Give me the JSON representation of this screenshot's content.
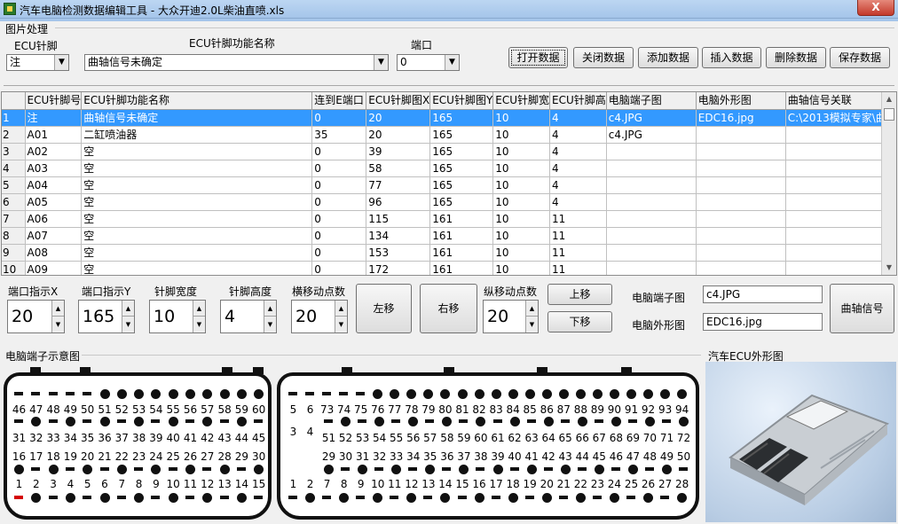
{
  "window": {
    "title": "汽车电脑检测数据编辑工具 - 大众开迪2.0L柴油直喷.xls",
    "close": "X"
  },
  "image_section": {
    "title": "图片处理"
  },
  "fields": {
    "ecu_pin": {
      "label": "ECU针脚",
      "value": "注"
    },
    "ecu_func": {
      "label": "ECU针脚功能名称",
      "value": "曲轴信号未确定"
    },
    "port": {
      "label": "端口",
      "value": "0"
    }
  },
  "buttons": {
    "open": "打开数据",
    "close": "关闭数据",
    "add": "添加数据",
    "insert": "插入数据",
    "delete": "删除数据",
    "save": "保存数据",
    "left": "左移",
    "right": "右移",
    "up": "上移",
    "down": "下移",
    "crank": "曲轴信号"
  },
  "table": {
    "columns": [
      "ECU针脚号",
      "ECU针脚功能名称",
      "连到E端口",
      "ECU针脚图X",
      "ECU针脚图Y",
      "ECU针脚宽",
      "ECU针脚高",
      "电脑端子图",
      "电脑外形图",
      "曲轴信号关联"
    ],
    "rows": [
      {
        "n": "1",
        "c": [
          "注",
          "曲轴信号未确定",
          "0",
          "20",
          "165",
          "10",
          "4",
          "c4.JPG",
          "EDC16.jpg",
          "C:\\2013模拟专家\\曲"
        ]
      },
      {
        "n": "2",
        "c": [
          "A01",
          "二缸喷油器",
          "35",
          "20",
          "165",
          "10",
          "4",
          "c4.JPG",
          "",
          ""
        ]
      },
      {
        "n": "3",
        "c": [
          "A02",
          "空",
          "0",
          "39",
          "165",
          "10",
          "4",
          "",
          "",
          ""
        ]
      },
      {
        "n": "4",
        "c": [
          "A03",
          "空",
          "0",
          "58",
          "165",
          "10",
          "4",
          "",
          "",
          ""
        ]
      },
      {
        "n": "5",
        "c": [
          "A04",
          "空",
          "0",
          "77",
          "165",
          "10",
          "4",
          "",
          "",
          ""
        ]
      },
      {
        "n": "6",
        "c": [
          "A05",
          "空",
          "0",
          "96",
          "165",
          "10",
          "4",
          "",
          "",
          ""
        ]
      },
      {
        "n": "7",
        "c": [
          "A06",
          "空",
          "0",
          "115",
          "161",
          "10",
          "11",
          "",
          "",
          ""
        ]
      },
      {
        "n": "8",
        "c": [
          "A07",
          "空",
          "0",
          "134",
          "161",
          "10",
          "11",
          "",
          "",
          ""
        ]
      },
      {
        "n": "9",
        "c": [
          "A08",
          "空",
          "0",
          "153",
          "161",
          "10",
          "11",
          "",
          "",
          ""
        ]
      },
      {
        "n": "10",
        "c": [
          "A09",
          "空",
          "0",
          "172",
          "161",
          "10",
          "11",
          "",
          "",
          ""
        ]
      }
    ]
  },
  "controls": {
    "port_x": {
      "label": "端口指示X",
      "value": "20"
    },
    "port_y": {
      "label": "端口指示Y",
      "value": "165"
    },
    "pin_width": {
      "label": "针脚宽度",
      "value": "10"
    },
    "pin_height": {
      "label": "针脚高度",
      "value": "4"
    },
    "hmove": {
      "label": "横移动点数",
      "value": "20"
    },
    "vmove": {
      "label": "纵移动点数",
      "value": "20"
    },
    "terminal_img": {
      "label": "电脑端子图",
      "value": "c4.JPG"
    },
    "outline_img": {
      "label": "电脑外形图",
      "value": "EDC16.jpg"
    }
  },
  "diagram": {
    "title": "电脑端子示意图",
    "left": {
      "row1": [
        "46",
        "47",
        "48",
        "49",
        "50",
        "51",
        "52",
        "53",
        "54",
        "55",
        "56",
        "57",
        "58",
        "59",
        "60"
      ],
      "row2": [
        "31",
        "32",
        "33",
        "34",
        "35",
        "36",
        "37",
        "38",
        "39",
        "40",
        "41",
        "42",
        "43",
        "44",
        "45"
      ],
      "row3": [
        "16",
        "17",
        "18",
        "19",
        "20",
        "21",
        "22",
        "23",
        "24",
        "25",
        "26",
        "27",
        "28",
        "29",
        "30"
      ],
      "row4": [
        "1",
        "2",
        "3",
        "4",
        "5",
        "6",
        "7",
        "8",
        "9",
        "10",
        "11",
        "12",
        "13",
        "14",
        "15"
      ]
    },
    "right": {
      "row1": [
        "5",
        "6",
        "73",
        "74",
        "75",
        "76",
        "77",
        "78",
        "79",
        "80",
        "81",
        "82",
        "83",
        "84",
        "85",
        "86",
        "87",
        "88",
        "89",
        "90",
        "91",
        "92",
        "93",
        "94"
      ],
      "row2_side": [
        "3",
        "4"
      ],
      "row2": [
        "51",
        "52",
        "53",
        "54",
        "55",
        "56",
        "57",
        "58",
        "59",
        "60",
        "61",
        "62",
        "63",
        "64",
        "65",
        "66",
        "67",
        "68",
        "69",
        "70",
        "71",
        "72"
      ],
      "row3": [
        "29",
        "30",
        "31",
        "32",
        "33",
        "34",
        "35",
        "36",
        "37",
        "38",
        "39",
        "40",
        "41",
        "42",
        "43",
        "44",
        "45",
        "46",
        "47",
        "48",
        "49",
        "50"
      ],
      "row4": [
        "1",
        "2",
        "7",
        "8",
        "9",
        "10",
        "11",
        "12",
        "13",
        "14",
        "15",
        "16",
        "17",
        "18",
        "19",
        "20",
        "21",
        "22",
        "23",
        "24",
        "25",
        "26",
        "27",
        "28"
      ]
    }
  },
  "photo": {
    "title": "汽车ECU外形图"
  }
}
